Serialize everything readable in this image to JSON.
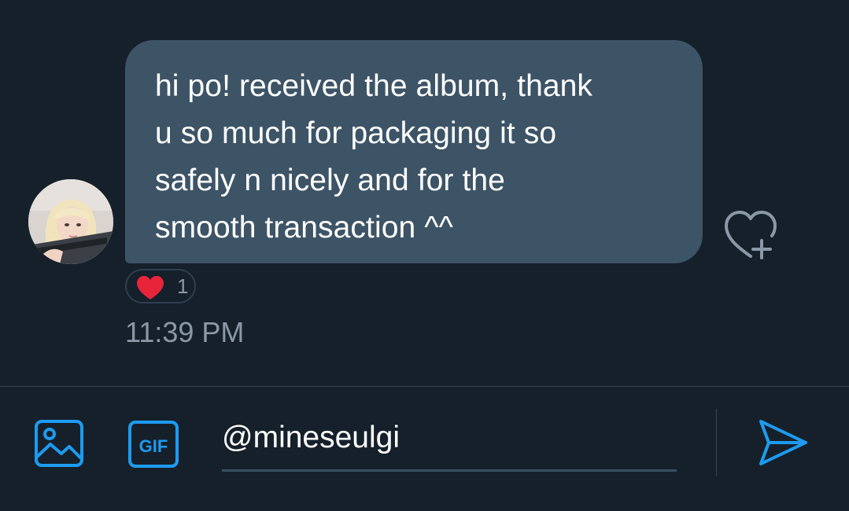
{
  "conversation": {
    "message": {
      "text": "hi po! received the album, thank\nu so much for packaging it so\nsafely n nicely and for the\nsmooth transaction ^^",
      "reaction_emoji": "red-heart",
      "reaction_count": "1",
      "time": "11:39 PM"
    },
    "avatar_icon": "user-avatar",
    "react_icon": "heart-plus-icon"
  },
  "composer": {
    "value": "@mineseulgi",
    "media_icon": "image-icon",
    "gif_icon": "gif-icon",
    "gif_label": "GIF",
    "send_icon": "send-icon"
  },
  "colors": {
    "background": "#15202b",
    "bubble": "#3d5466",
    "accent": "#1d9bf0",
    "muted_text": "#8b98a5",
    "heart": "#e8243b"
  }
}
